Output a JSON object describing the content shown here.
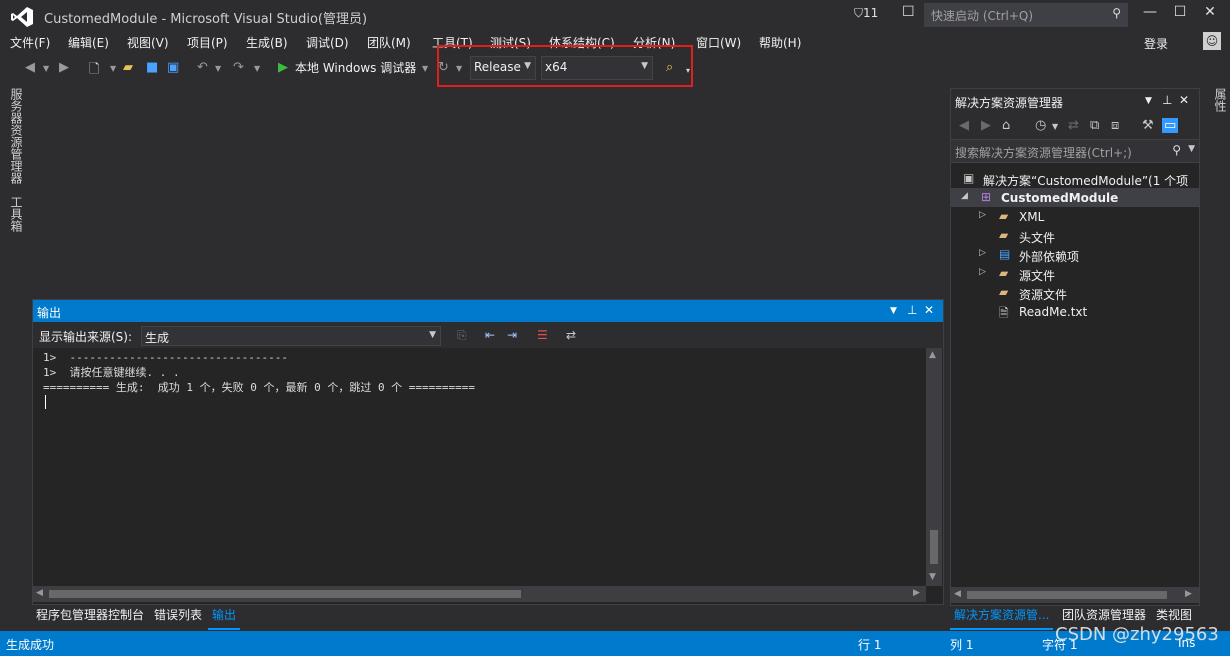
{
  "window": {
    "title": "CustomedModule - Microsoft Visual Studio(管理员)",
    "notifications_count": "11",
    "quick_launch_placeholder": "快速启动 (Ctrl+Q)",
    "login": "登录"
  },
  "menu": [
    "文件(F)",
    "编辑(E)",
    "视图(V)",
    "项目(P)",
    "生成(B)",
    "调试(D)",
    "团队(M)",
    "工具(T)",
    "测试(S)",
    "体系结构(C)",
    "分析(N)",
    "窗口(W)",
    "帮助(H)"
  ],
  "toolbar": {
    "run_label": "本地 Windows 调试器",
    "configuration": "Release",
    "platform": "x64"
  },
  "left_strip": [
    "服务器资源管理器",
    "工具箱"
  ],
  "right_strip": [
    "属性"
  ],
  "output": {
    "title": "输出",
    "source_label": "显示输出来源(S):",
    "source_value": "生成",
    "lines": [
      "1>  ---------------------------------",
      "1>  请按任意键继续. . .",
      "========== 生成:  成功 1 个，失败 0 个，最新 0 个，跳过 0 个 =========="
    ]
  },
  "bottom_tabs_left": [
    "程序包管理器控制台",
    "错误列表",
    "输出"
  ],
  "solution_explorer": {
    "title": "解决方案资源管理器",
    "search_placeholder": "搜索解决方案资源管理器(Ctrl+;)",
    "tree": [
      {
        "label": "解决方案“CustomedModule”(1 个项",
        "icon": "solution-icon"
      },
      {
        "label": "CustomedModule",
        "icon": "project-icon"
      },
      {
        "label": "XML",
        "icon": "folder-icon"
      },
      {
        "label": "头文件",
        "icon": "folder-icon"
      },
      {
        "label": "外部依赖项",
        "icon": "dependencies-icon"
      },
      {
        "label": "源文件",
        "icon": "folder-icon"
      },
      {
        "label": "资源文件",
        "icon": "folder-icon"
      },
      {
        "label": "ReadMe.txt",
        "icon": "file-icon"
      }
    ]
  },
  "bottom_tabs_right": [
    "解决方案资源管...",
    "团队资源管理器",
    "类视图"
  ],
  "status": {
    "message": "生成成功",
    "line": "行 1",
    "col": "列 1",
    "char": "字符 1",
    "mode": "Ins"
  },
  "watermark": "CSDN @zhy29563",
  "colors": {
    "accent": "#007acc",
    "highlight_box": "#e02020",
    "background": "#2d2d30"
  }
}
